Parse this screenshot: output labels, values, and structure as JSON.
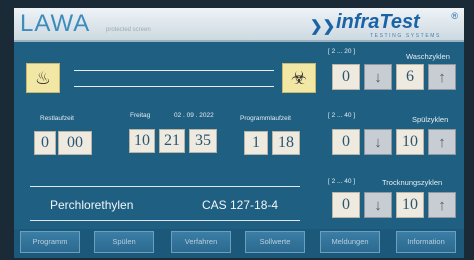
{
  "header": {
    "title": "LAWA",
    "subtitle": "protected screen",
    "logo_brand": "infraTest",
    "logo_sub": "TESTING SYSTEMS",
    "logo_mark": "®"
  },
  "icons": {
    "heat_warning": "hot-surface-warning-icon",
    "env_warning": "environment-hazard-icon",
    "down": "arrow-down-icon",
    "up": "arrow-up-icon"
  },
  "timers": {
    "remaining": {
      "label": "Restlaufzeit",
      "h": "0",
      "m": "00"
    },
    "datetime": {
      "day": "Freitag",
      "date": "02 . 09 . 2022",
      "hh": "10",
      "mm": "21",
      "ss": "35"
    },
    "program": {
      "label": "Programmlaufzeit",
      "h": "1",
      "m": "18"
    }
  },
  "cycles": {
    "wash": {
      "range": "[ 2 ... 20 ]",
      "label": "Waschzyklen",
      "min": "0",
      "value": "6"
    },
    "rinse": {
      "range": "[ 2 ... 40 ]",
      "label": "Spülzyklen",
      "min": "0",
      "value": "10"
    },
    "dry": {
      "range": "[ 2 ... 40 ]",
      "label": "Trocknungszyklen",
      "min": "0",
      "value": "10"
    }
  },
  "chemical": {
    "name": "Perchlorethylen",
    "cas": "CAS 127-18-4"
  },
  "nav": [
    "Programm",
    "Spülen",
    "Verfahren",
    "Sollwerte",
    "Meldungen",
    "Information"
  ],
  "colors": {
    "background": "#1f5f82",
    "accent": "#1a63a6",
    "warning": "#f3e7a6"
  }
}
